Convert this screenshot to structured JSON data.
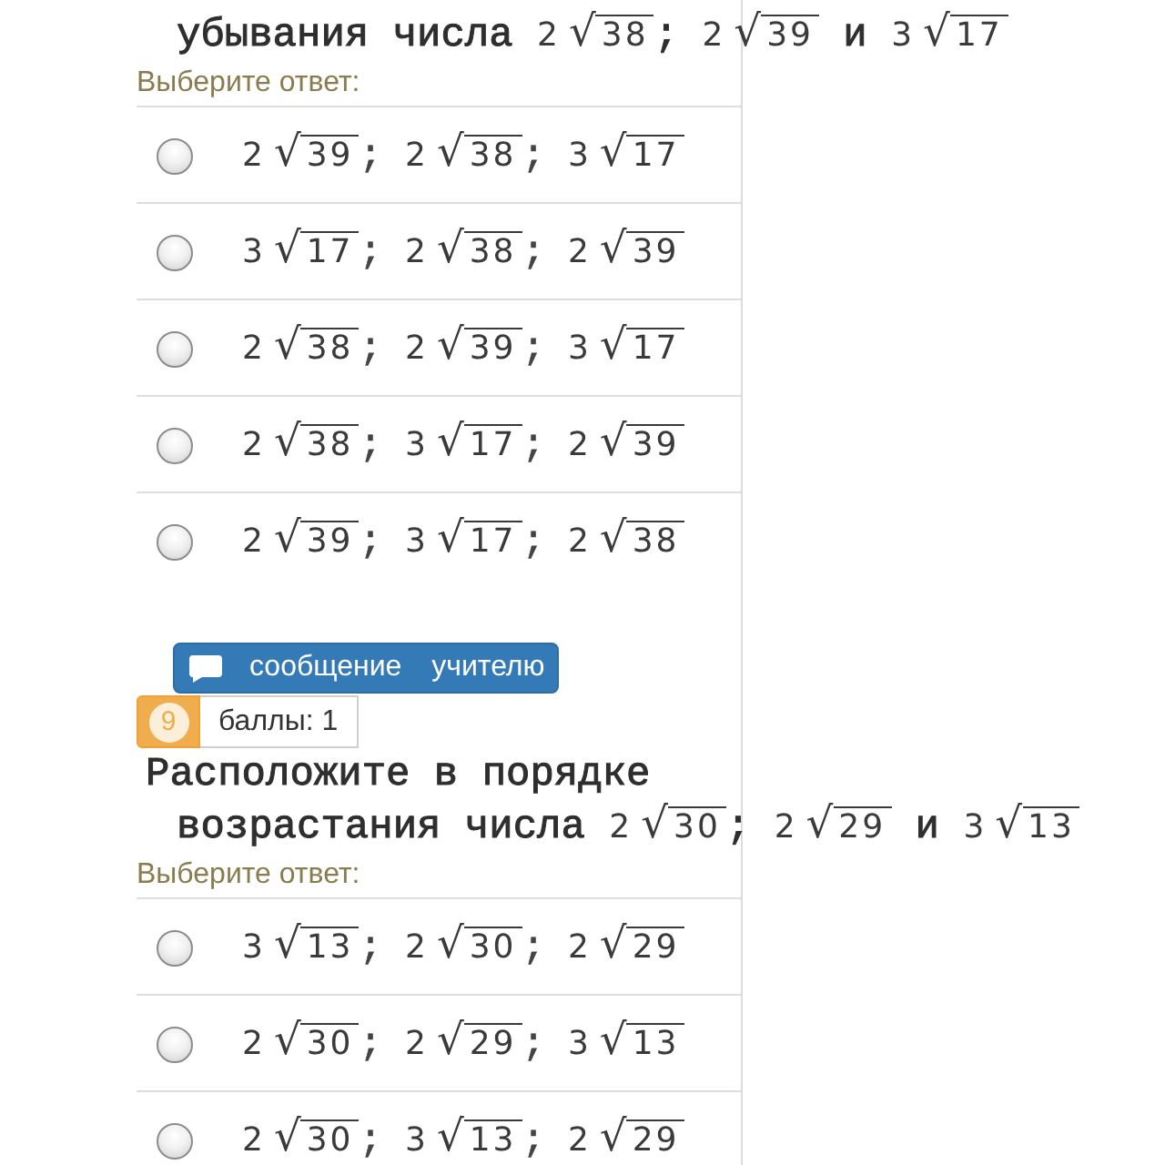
{
  "questions": [
    {
      "text_lines": [
        {
          "indented": true,
          "tokens": [
            {
              "kind": "text",
              "text": "убывания числа "
            },
            {
              "kind": "root",
              "coef": "2",
              "sign": "√",
              "radicand": "38"
            },
            {
              "kind": "text",
              "text": "; "
            },
            {
              "kind": "root",
              "coef": "2",
              "sign": "√",
              "radicand": "39"
            },
            {
              "kind": "text",
              "text": " и "
            },
            {
              "kind": "root",
              "coef": "3",
              "sign": "√",
              "radicand": "17"
            }
          ]
        }
      ],
      "prompt": "Выберите ответ:",
      "options": [
        {
          "selected": false,
          "tokens": [
            {
              "kind": "root",
              "coef": "2",
              "sign": "√",
              "radicand": "39"
            },
            {
              "kind": "text",
              "text": "; "
            },
            {
              "kind": "root",
              "coef": "2",
              "sign": "√",
              "radicand": "38"
            },
            {
              "kind": "text",
              "text": "; "
            },
            {
              "kind": "root",
              "coef": "3",
              "sign": "√",
              "radicand": "17"
            }
          ]
        },
        {
          "selected": false,
          "tokens": [
            {
              "kind": "root",
              "coef": "3",
              "sign": "√",
              "radicand": "17"
            },
            {
              "kind": "text",
              "text": "; "
            },
            {
              "kind": "root",
              "coef": "2",
              "sign": "√",
              "radicand": "38"
            },
            {
              "kind": "text",
              "text": "; "
            },
            {
              "kind": "root",
              "coef": "2",
              "sign": "√",
              "radicand": "39"
            }
          ]
        },
        {
          "selected": false,
          "tokens": [
            {
              "kind": "root",
              "coef": "2",
              "sign": "√",
              "radicand": "38"
            },
            {
              "kind": "text",
              "text": "; "
            },
            {
              "kind": "root",
              "coef": "2",
              "sign": "√",
              "radicand": "39"
            },
            {
              "kind": "text",
              "text": "; "
            },
            {
              "kind": "root",
              "coef": "3",
              "sign": "√",
              "radicand": "17"
            }
          ]
        },
        {
          "selected": false,
          "tokens": [
            {
              "kind": "root",
              "coef": "2",
              "sign": "√",
              "radicand": "38"
            },
            {
              "kind": "text",
              "text": "; "
            },
            {
              "kind": "root",
              "coef": "3",
              "sign": "√",
              "radicand": "17"
            },
            {
              "kind": "text",
              "text": "; "
            },
            {
              "kind": "root",
              "coef": "2",
              "sign": "√",
              "radicand": "39"
            }
          ]
        },
        {
          "selected": false,
          "tokens": [
            {
              "kind": "root",
              "coef": "2",
              "sign": "√",
              "radicand": "39"
            },
            {
              "kind": "text",
              "text": "; "
            },
            {
              "kind": "root",
              "coef": "3",
              "sign": "√",
              "radicand": "17"
            },
            {
              "kind": "text",
              "text": "; "
            },
            {
              "kind": "root",
              "coef": "2",
              "sign": "√",
              "radicand": "38"
            }
          ]
        }
      ]
    },
    {
      "message_button": {
        "label": "сообщение учителю"
      },
      "number": "9",
      "score": "баллы: 1",
      "text_lines": [
        {
          "indented": false,
          "tokens": [
            {
              "kind": "text",
              "text": "Расположите в порядке"
            }
          ]
        },
        {
          "indented": true,
          "tokens": [
            {
              "kind": "text",
              "text": "возрастания числа "
            },
            {
              "kind": "root",
              "coef": "2",
              "sign": "√",
              "radicand": "30"
            },
            {
              "kind": "text",
              "text": "; "
            },
            {
              "kind": "root",
              "coef": "2",
              "sign": "√",
              "radicand": "29"
            },
            {
              "kind": "text",
              "text": " и "
            },
            {
              "kind": "root",
              "coef": "3",
              "sign": "√",
              "radicand": "13"
            }
          ]
        }
      ],
      "prompt": "Выберите ответ:",
      "options": [
        {
          "selected": false,
          "tokens": [
            {
              "kind": "root",
              "coef": "3",
              "sign": "√",
              "radicand": "13"
            },
            {
              "kind": "text",
              "text": "; "
            },
            {
              "kind": "root",
              "coef": "2",
              "sign": "√",
              "radicand": "30"
            },
            {
              "kind": "text",
              "text": "; "
            },
            {
              "kind": "root",
              "coef": "2",
              "sign": "√",
              "radicand": "29"
            }
          ]
        },
        {
          "selected": false,
          "tokens": [
            {
              "kind": "root",
              "coef": "2",
              "sign": "√",
              "radicand": "30"
            },
            {
              "kind": "text",
              "text": "; "
            },
            {
              "kind": "root",
              "coef": "2",
              "sign": "√",
              "radicand": "29"
            },
            {
              "kind": "text",
              "text": "; "
            },
            {
              "kind": "root",
              "coef": "3",
              "sign": "√",
              "radicand": "13"
            }
          ]
        },
        {
          "selected": false,
          "tokens": [
            {
              "kind": "root",
              "coef": "2",
              "sign": "√",
              "radicand": "30"
            },
            {
              "kind": "text",
              "text": "; "
            },
            {
              "kind": "root",
              "coef": "3",
              "sign": "√",
              "radicand": "13"
            },
            {
              "kind": "text",
              "text": "; "
            },
            {
              "kind": "root",
              "coef": "2",
              "sign": "√",
              "radicand": "29"
            }
          ]
        }
      ]
    }
  ]
}
